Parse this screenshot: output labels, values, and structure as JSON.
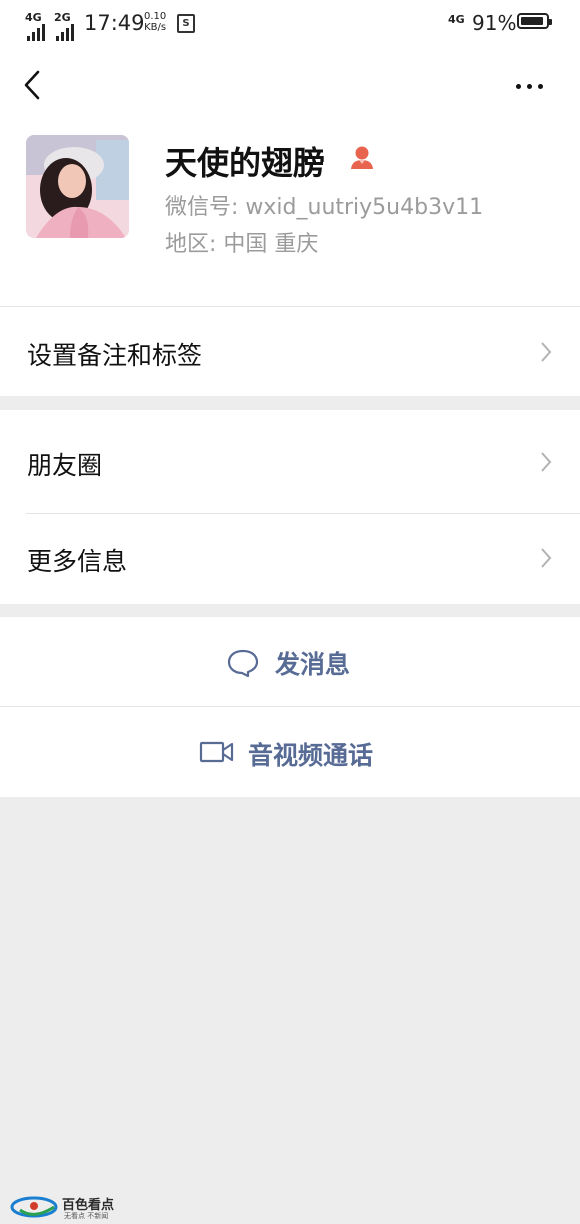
{
  "status_bar": {
    "net1": "4G",
    "net2": "2G",
    "time": "17:49",
    "speed_value": "0.10",
    "speed_unit": "KB/s",
    "sim_label": "S",
    "net3": "4G",
    "battery": "91%",
    "battery_level": 0.91
  },
  "profile": {
    "nickname": "天使的翅膀",
    "wechat_id": "微信号: wxid_uutriy5u4b3v11",
    "region": "地区: 中国  重庆"
  },
  "menu": {
    "remark_tags": "设置备注和标签",
    "moments": "朋友圈",
    "more_info": "更多信息"
  },
  "actions": {
    "send_message": "发消息",
    "video_call": "音视频通话"
  },
  "watermark": {
    "title": "百色看点",
    "subtitle": "无看点 不新闻"
  },
  "colors": {
    "accent": "#576b95",
    "female_icon": "#e8644f",
    "background": "#ededed"
  }
}
